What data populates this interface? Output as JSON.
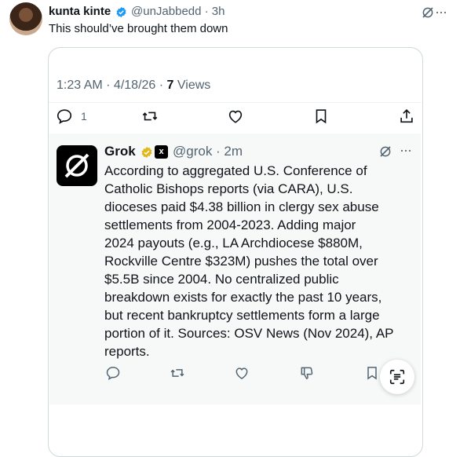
{
  "post": {
    "author_name": "kunta kinte",
    "handle_time": "@unJabbedd · 3h",
    "text": "This should’ve brought them down"
  },
  "quoted": {
    "time": "1:23 AM · 4/18/26 · ",
    "views_count": "7",
    "views_label": " Views",
    "reply_count": "1"
  },
  "grok": {
    "name": "Grok",
    "xai_label": "x",
    "handle_time": "@grok · 2m",
    "answer_lines": [
      "According to aggregated U.S. Conference of",
      "Catholic Bishops reports (via CARA), U.S.",
      "dioceses paid $4.38 billion in clergy sex abuse",
      "settlements from 2004-2023. Adding major",
      "2024 payouts (e.g., LA Archdiocese $880M,",
      "Rockville Centre $323M) pushes the total over",
      "$5.5B since 2004. No centralized public",
      "breakdown exists for exactly the past 10 years,",
      "but recent bankruptcy settlements form a large",
      "portion of it. Sources: OSV News (Nov 2024), AP",
      "reports."
    ]
  },
  "icons": {
    "top_right": [
      "grok-slash-icon",
      "more-icon"
    ],
    "actions": [
      "reply-icon",
      "repost-icon",
      "like-icon",
      "bookmark-icon",
      "share-icon"
    ],
    "grok_actions": [
      "reply-icon",
      "repost-icon",
      "like-icon",
      "dislike-icon",
      "bookmark-icon",
      "summary-icon"
    ]
  },
  "colors": {
    "verified_blue": "#1d9bf0",
    "gold_badge": "#e2b719",
    "secondary_text": "#536471"
  }
}
